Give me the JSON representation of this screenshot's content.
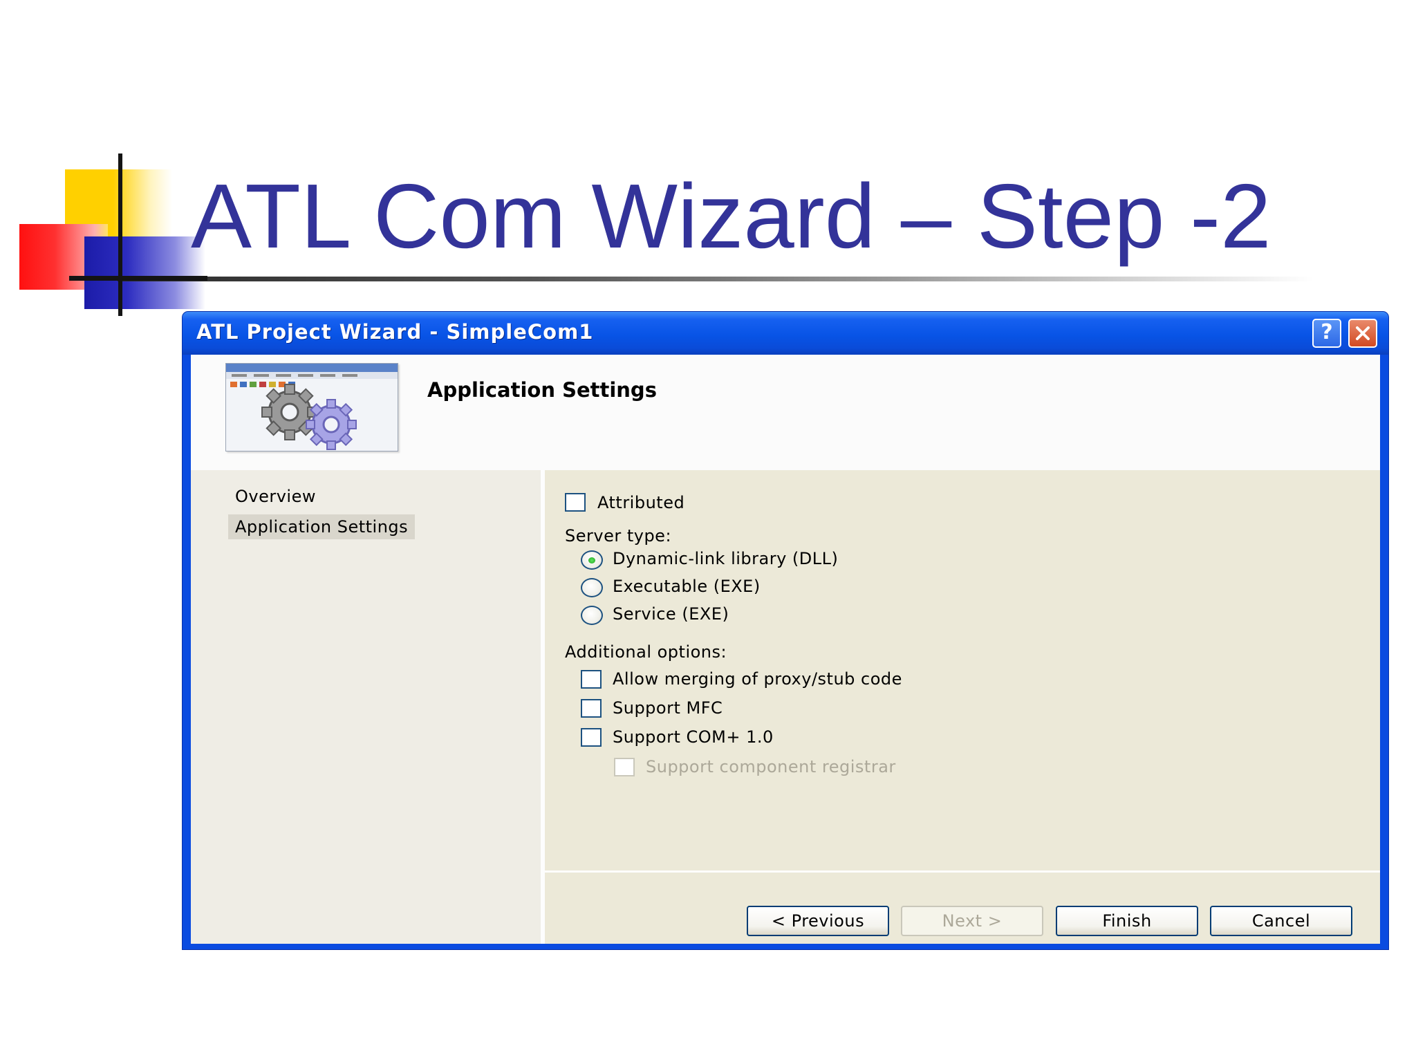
{
  "slide": {
    "title": "ATL Com Wizard – Step -2"
  },
  "dialog": {
    "window_title": "ATL Project Wizard - SimpleCom1",
    "help_label": "?",
    "header_title": "Application Settings",
    "nav_items": [
      {
        "label": "Overview",
        "selected": false
      },
      {
        "label": "Application Settings",
        "selected": true
      }
    ],
    "options": {
      "attributed": {
        "label": "Attributed",
        "checked": false
      },
      "server_type_label": "Server type:",
      "server_types": [
        {
          "label": "Dynamic-link library (DLL)",
          "selected": true
        },
        {
          "label": "Executable (EXE)",
          "selected": false
        },
        {
          "label": "Service (EXE)",
          "selected": false
        }
      ],
      "additional_label": "Additional options:",
      "additional": [
        {
          "label": "Allow merging of proxy/stub code",
          "checked": false,
          "enabled": true
        },
        {
          "label": "Support MFC",
          "checked": false,
          "enabled": true
        },
        {
          "label": "Support COM+ 1.0",
          "checked": false,
          "enabled": true
        },
        {
          "label": "Support component registrar",
          "checked": false,
          "enabled": false
        }
      ]
    },
    "buttons": {
      "previous": "< Previous",
      "next": "Next >",
      "finish": "Finish",
      "cancel": "Cancel"
    }
  },
  "colors": {
    "slide_title": "#333399",
    "titlebar": "#0a4be0",
    "dialog_face": "#ece9d8",
    "disabled_text": "#aca899"
  },
  "icons": [
    "help-icon",
    "close-icon",
    "gears-icon"
  ]
}
